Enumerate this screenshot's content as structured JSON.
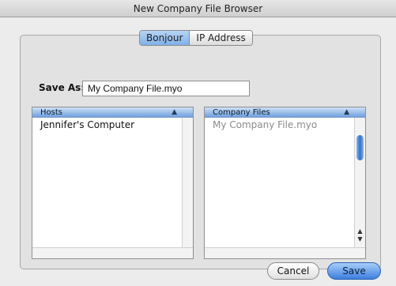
{
  "window": {
    "title": "New Company File Browser"
  },
  "tabs": [
    {
      "label": "Bonjour"
    },
    {
      "label": "IP Address"
    }
  ],
  "save_as": {
    "label": "Save As:",
    "value": "My Company File.myo"
  },
  "hosts": {
    "header": "Hosts",
    "sort_indicator": "▲",
    "items": [
      "Jennifer's Computer"
    ]
  },
  "company_files": {
    "header": "Company Files",
    "sort_indicator": "▲",
    "items": [
      "My Company File.myo"
    ]
  },
  "buttons": {
    "cancel": "Cancel",
    "save": "Save"
  },
  "colors": {
    "accent": "#3d7fe0",
    "window_bg": "#ececec"
  }
}
